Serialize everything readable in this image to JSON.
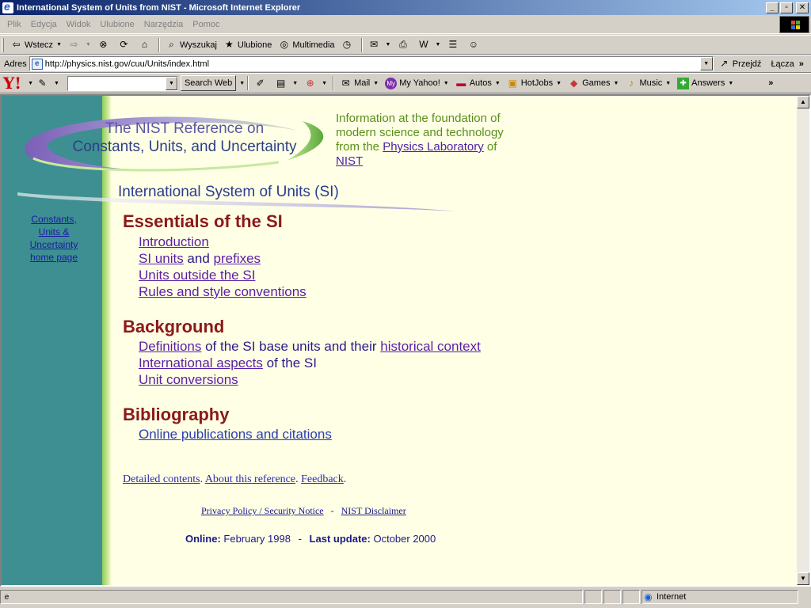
{
  "window": {
    "title": "International System of Units from NIST - Microsoft Internet Explorer",
    "buttons": {
      "minimize": "_",
      "maximize": "▫",
      "close": "✕"
    }
  },
  "menu": [
    "Plik",
    "Edycja",
    "Widok",
    "Ulubione",
    "Narzędzia",
    "Pomoc"
  ],
  "toolbar": {
    "back": "Wstecz",
    "search": "Wyszukaj",
    "favorites": "Ulubione",
    "media": "Multimedia"
  },
  "address_bar": {
    "label": "Adres",
    "url": "http://physics.nist.gov/cuu/Units/index.html",
    "go": "Przejdź",
    "links": "Łącza"
  },
  "yahoo_bar": {
    "logo": "Y!",
    "search_placeholder": "",
    "search_button": "Search Web",
    "items": [
      "Mail",
      "My Yahoo!",
      "Autos",
      "HotJobs",
      "Games",
      "Music",
      "Answers"
    ]
  },
  "page": {
    "logo": {
      "line1": "The NIST Reference on",
      "line2": "Constants, Units, and Uncertainty"
    },
    "tagline": {
      "text1": "Information at the foundation of modern science and technology from the ",
      "link1": "Physics Laboratory",
      "text2": " of ",
      "link2": "NIST"
    },
    "si_title": "International System of Units (SI)",
    "side_link": "Constants, Units & Uncertainty home page",
    "sections": [
      {
        "heading": "Essentials of the SI",
        "items": [
          {
            "link": "Introduction"
          },
          {
            "link": "SI units",
            "text": " and ",
            "link2": "prefixes"
          },
          {
            "link": "Units outside the SI"
          },
          {
            "link": "Rules and style conventions"
          }
        ]
      },
      {
        "heading": "Background",
        "items": [
          {
            "link": "Definitions",
            "text": " of the SI base units and their ",
            "link2": "historical context"
          },
          {
            "link": "International aspects",
            "text": " of the SI"
          },
          {
            "link": "Unit conversions"
          }
        ]
      },
      {
        "heading": "Bibliography",
        "items": [
          {
            "link": "Online publications and citations"
          }
        ]
      }
    ],
    "footer": {
      "detailed": "Detailed contents",
      "about": "About this reference",
      "feedback": "Feedback",
      "privacy": "Privacy Policy / Security Notice",
      "sep": " - ",
      "disclaimer": "NIST Disclaimer",
      "online_label": "Online:",
      "online_date": "February 1998",
      "update_label": "Last update:",
      "update_date": "October 2000"
    }
  },
  "status_bar": {
    "zone": "Internet"
  }
}
